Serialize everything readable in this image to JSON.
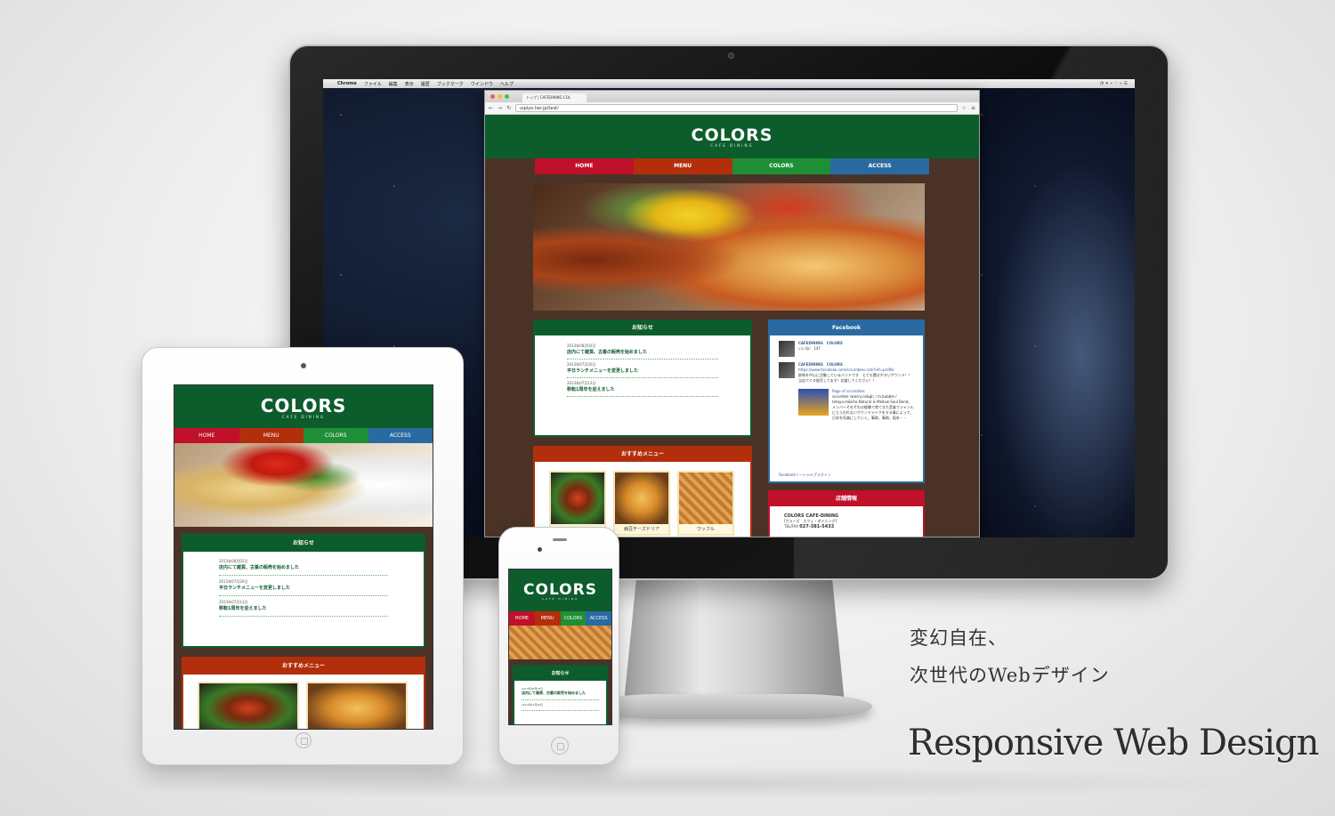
{
  "menubar": {
    "apple": "",
    "app": "Chrome",
    "items": [
      "ファイル",
      "編集",
      "表示",
      "履歴",
      "ブックマーク",
      "ウインドウ",
      "ヘルプ"
    ]
  },
  "browser": {
    "tab_title": "トップ | CAFEDINING COL",
    "url": "uipiyo.her.jp/test/"
  },
  "site": {
    "logo": "COLORS",
    "logo_sub": "CAFE DINING",
    "nav": [
      "HOME",
      "MENU",
      "COLORS",
      "ACCESS"
    ],
    "news": {
      "title": "お知らせ",
      "items": [
        {
          "date": "2013年08月02日",
          "title": "店内にて雑貨、古着の販売を始めました"
        },
        {
          "date": "2013年07月20日",
          "title": "平日ランチメニューを変更しました"
        },
        {
          "date": "2013年07月13日",
          "title": "移転1周年を迎えました"
        }
      ]
    },
    "recommend": {
      "title": "おすすめメニュー",
      "items": [
        "",
        "納豆チーズドリア",
        "ワッフル"
      ]
    },
    "facebook": {
      "title": "Facebook",
      "page_name": "CAFEDINING　COLORS",
      "like_label": "いいね！",
      "like_count": "147",
      "post_name": "CAFEDINING　COLORS",
      "post_url": "https://www.facebook.com/scrumbles.ride?ref=profile",
      "post_text1": "群馬を中心に活動しているバンドです　とても聞きやすいサウンド！！",
      "post_text2": "当店でＣＤ販売してます！応援してください！！",
      "card_title": "Page of scrumbles",
      "card_text": "scrumble rwasry.co&gt; / m.bubble / tetaya.m&kha Natural & Mellow Soul Band。メンバーそれぞれの経験で育てきた音楽でジャンルにとらわれないサウンドメイクをする事によって、日本を気楽にしていく。事務、事務、祖本・・",
      "footer": "Facebookソーシャルプラグイン"
    },
    "shop": {
      "title": "店舗情報",
      "name": "COLORS CAFE-DINING",
      "kana": "[カラーズ　カフェ・ダイニング]",
      "tel_label": "TEL/FAX",
      "tel": "027-381-5433"
    }
  },
  "tablet": {
    "news_items": [
      {
        "date": "2013年08月02日",
        "title": "店内にて雑貨、古着の販売を始めました"
      },
      {
        "date": "2013年07月20日",
        "title": "平日ランチメニューを変更しました"
      },
      {
        "date": "2013年07月13日",
        "title": "移転1周年を迎えました"
      }
    ]
  },
  "phone": {
    "news_items": [
      {
        "date": "2013年08月02日",
        "title": "店内にて雑貨、古着の販売を始めました"
      },
      {
        "date": "2013年07月20日",
        "title": ""
      }
    ]
  },
  "tagline": {
    "line1": "変幻自在、",
    "line2": "次世代のWebデザイン",
    "headline": "Responsive Web Design"
  },
  "colors": {
    "green": "#0d5d2c",
    "red": "#c0102a",
    "orange": "#b32f0b",
    "leaf": "#1f8f36",
    "blue": "#2a6aa2",
    "brown": "#4a3326"
  }
}
